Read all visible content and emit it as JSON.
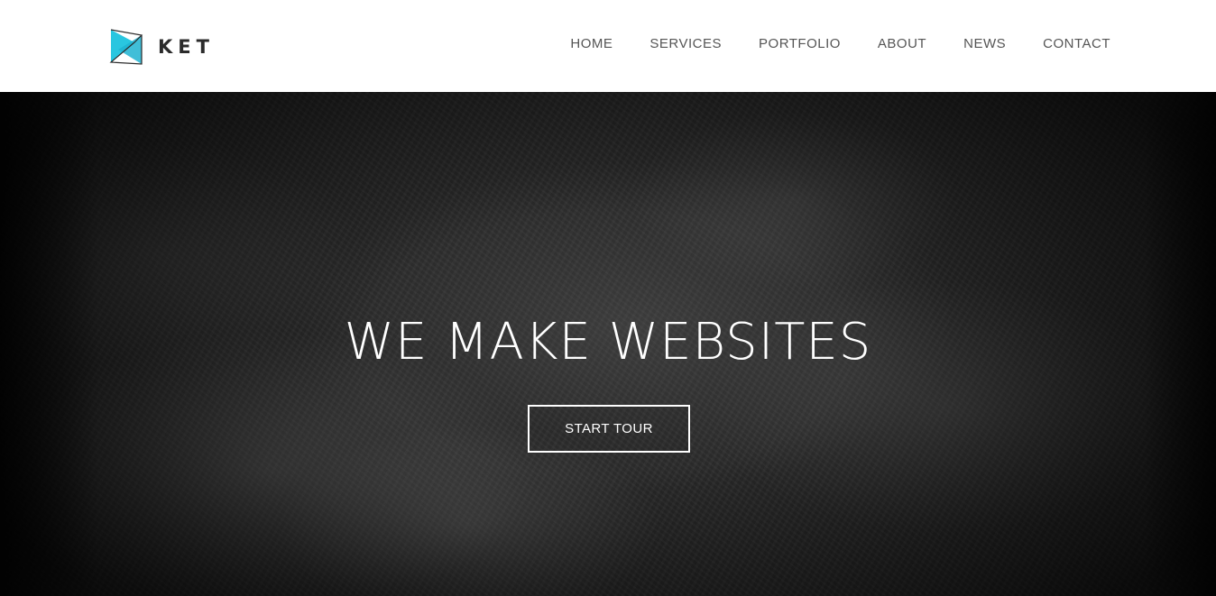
{
  "header": {
    "logo_text": "KET",
    "logo_icon": "triangle-logo-icon",
    "nav": [
      {
        "label": "HOME"
      },
      {
        "label": "SERVICES"
      },
      {
        "label": "PORTFOLIO"
      },
      {
        "label": "ABOUT"
      },
      {
        "label": "NEWS"
      },
      {
        "label": "CONTACT"
      }
    ]
  },
  "hero": {
    "title": "WE MAKE WEBSITES",
    "button_label": "START TOUR"
  },
  "colors": {
    "accent": "#29c6e0",
    "header_bg": "#ffffff",
    "nav_text": "#555555",
    "hero_text": "#ffffff"
  }
}
